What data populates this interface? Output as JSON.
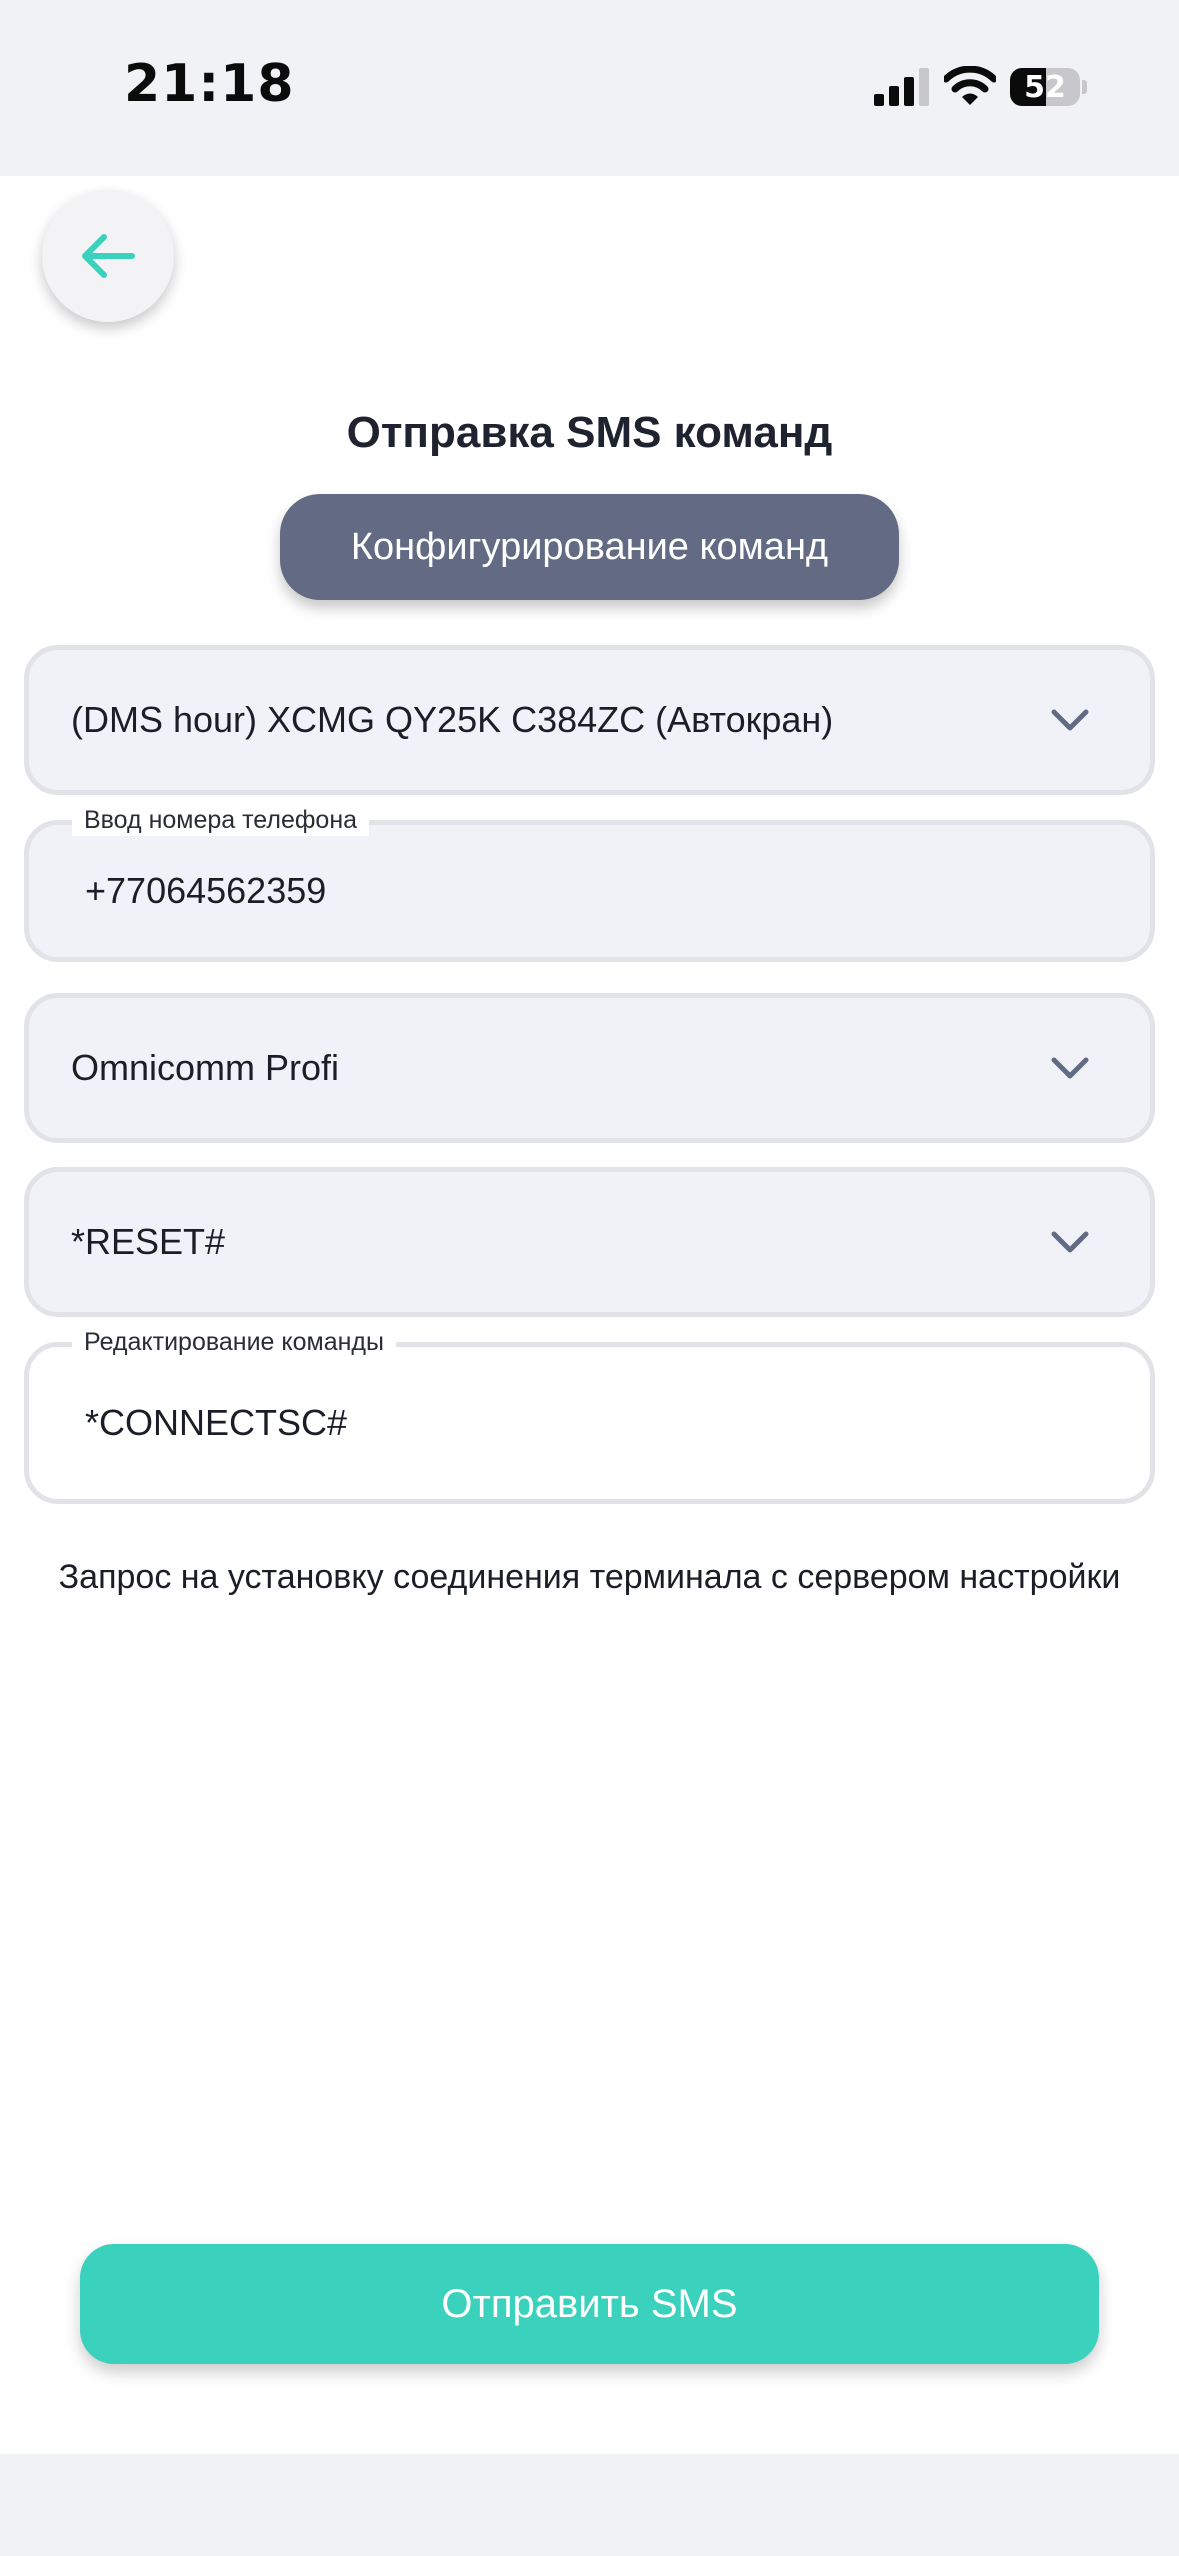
{
  "status_bar": {
    "time": "21:18",
    "battery_level": "52",
    "battery_fraction": 0.52,
    "icons": [
      "signal-icon",
      "wifi-icon",
      "battery-icon"
    ]
  },
  "header": {
    "back_icon": "arrow-left-icon",
    "title": "Отправка SMS команд",
    "config_button_label": "Конфигурирование команд"
  },
  "form": {
    "vehicle_select": {
      "value": "(DMS hour) XCMG QY25K C384ZC (Автокран)"
    },
    "phone_input": {
      "label": "Ввод номера телефона",
      "value": "+77064562359"
    },
    "terminal_select": {
      "value": "Omnicomm Profi"
    },
    "command_select": {
      "value": "*RESET#"
    },
    "command_edit": {
      "label": "Редактирование команды",
      "value": "*CONNECTSC#"
    }
  },
  "description": "Запрос на установку соединения терминала с сервером настройки",
  "footer": {
    "send_button_label": "Отправить SMS"
  },
  "colors": {
    "accent": "#3ad1bd",
    "config_button": "#636b84",
    "field_background": "#f0f2f7",
    "field_border": "#e1e3e8"
  }
}
